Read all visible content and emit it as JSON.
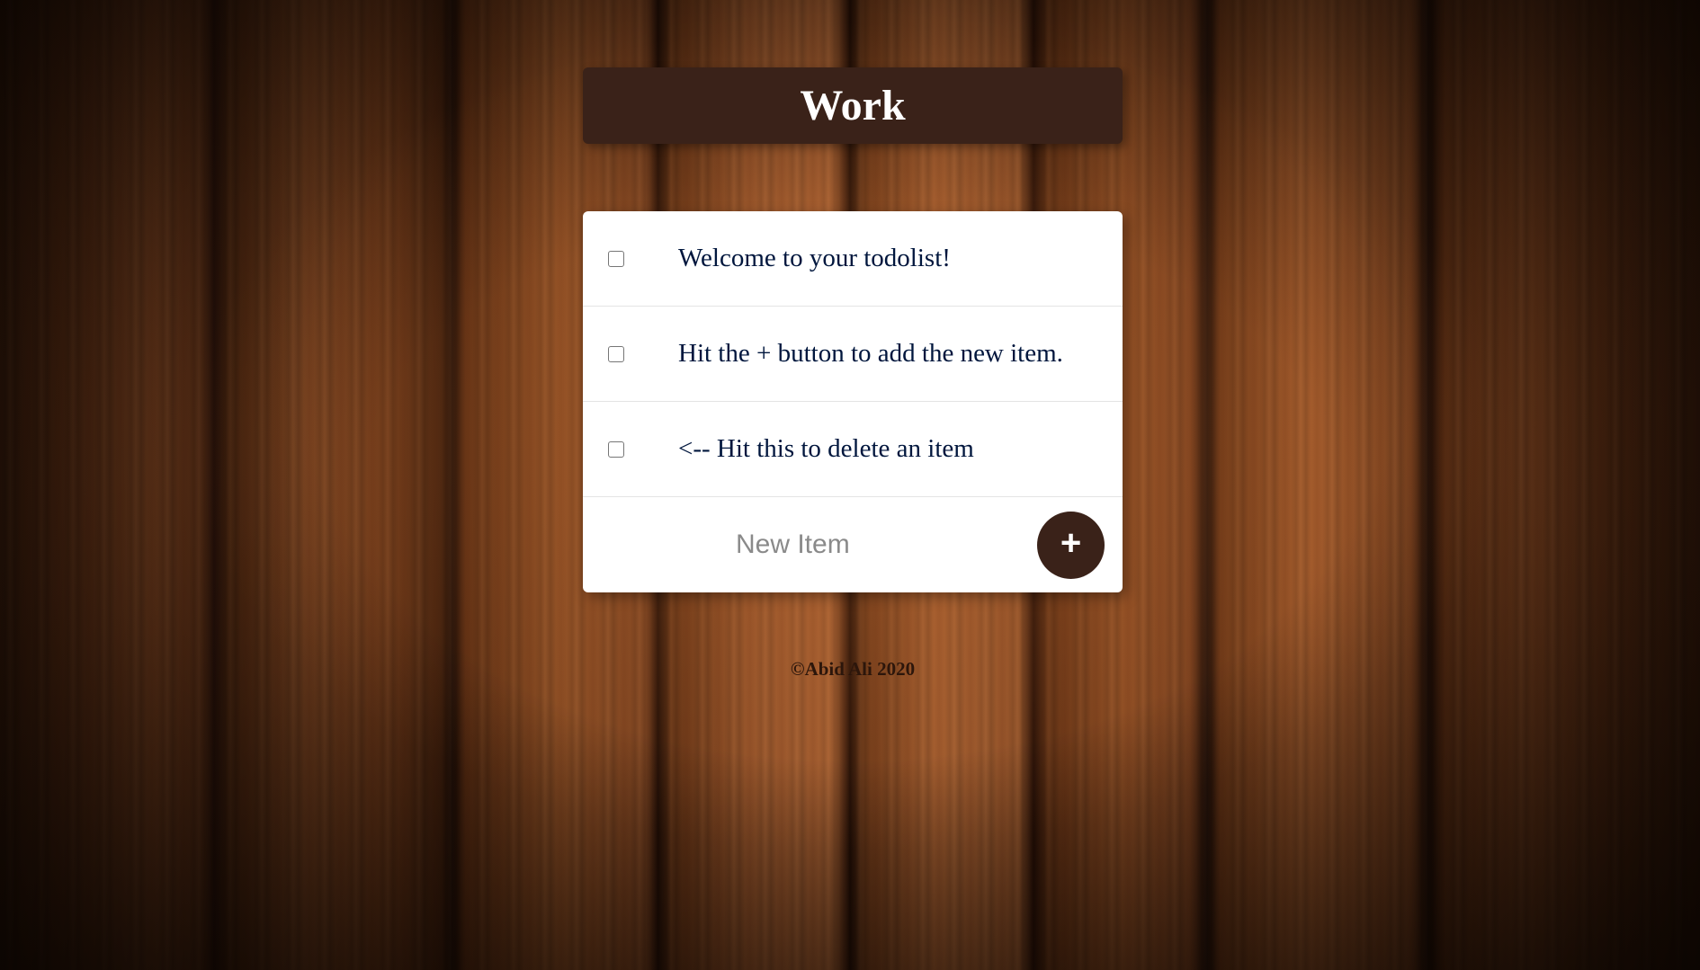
{
  "list": {
    "title": "Work",
    "items": [
      {
        "label": "Welcome to your todolist!"
      },
      {
        "label": "Hit the + button to add the new item."
      },
      {
        "label": "<-- Hit this to delete an item"
      }
    ],
    "new_item": {
      "placeholder": "New Item",
      "value": "",
      "add_button_label": "+"
    }
  },
  "footer": {
    "text": "©Abid Ali 2020"
  },
  "colors": {
    "header_bg": "#3a2219",
    "item_text": "#00163d",
    "add_button_bg": "#3a2219",
    "card_bg": "#ffffff"
  },
  "icons": {
    "add": "plus-icon",
    "checkbox": "checkbox-icon"
  }
}
